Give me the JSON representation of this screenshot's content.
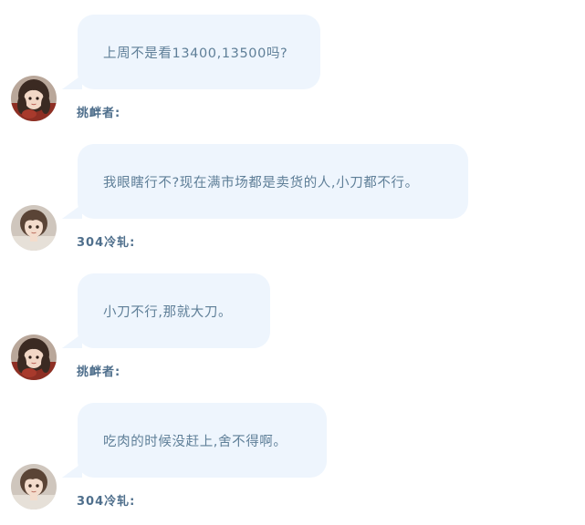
{
  "messages": [
    {
      "text": "上周不是看13400,13500吗?",
      "sender": "挑衅者:",
      "avatar": "girl-avatar-icon"
    },
    {
      "text": "我眼瞎行不?现在满市场都是卖货的人,小刀都不行。",
      "sender": "304冷轧:",
      "avatar": "boy-avatar-icon"
    },
    {
      "text": "小刀不行,那就大刀。",
      "sender": "挑衅者:",
      "avatar": "girl-avatar-icon"
    },
    {
      "text": "吃肉的时候没赶上,舍不得啊。",
      "sender": "304冷轧:",
      "avatar": "boy-avatar-icon"
    }
  ],
  "colors": {
    "bubble": "#eef5fd",
    "bubble_text": "#5f7f98",
    "sender_text": "#4f6f8c"
  }
}
